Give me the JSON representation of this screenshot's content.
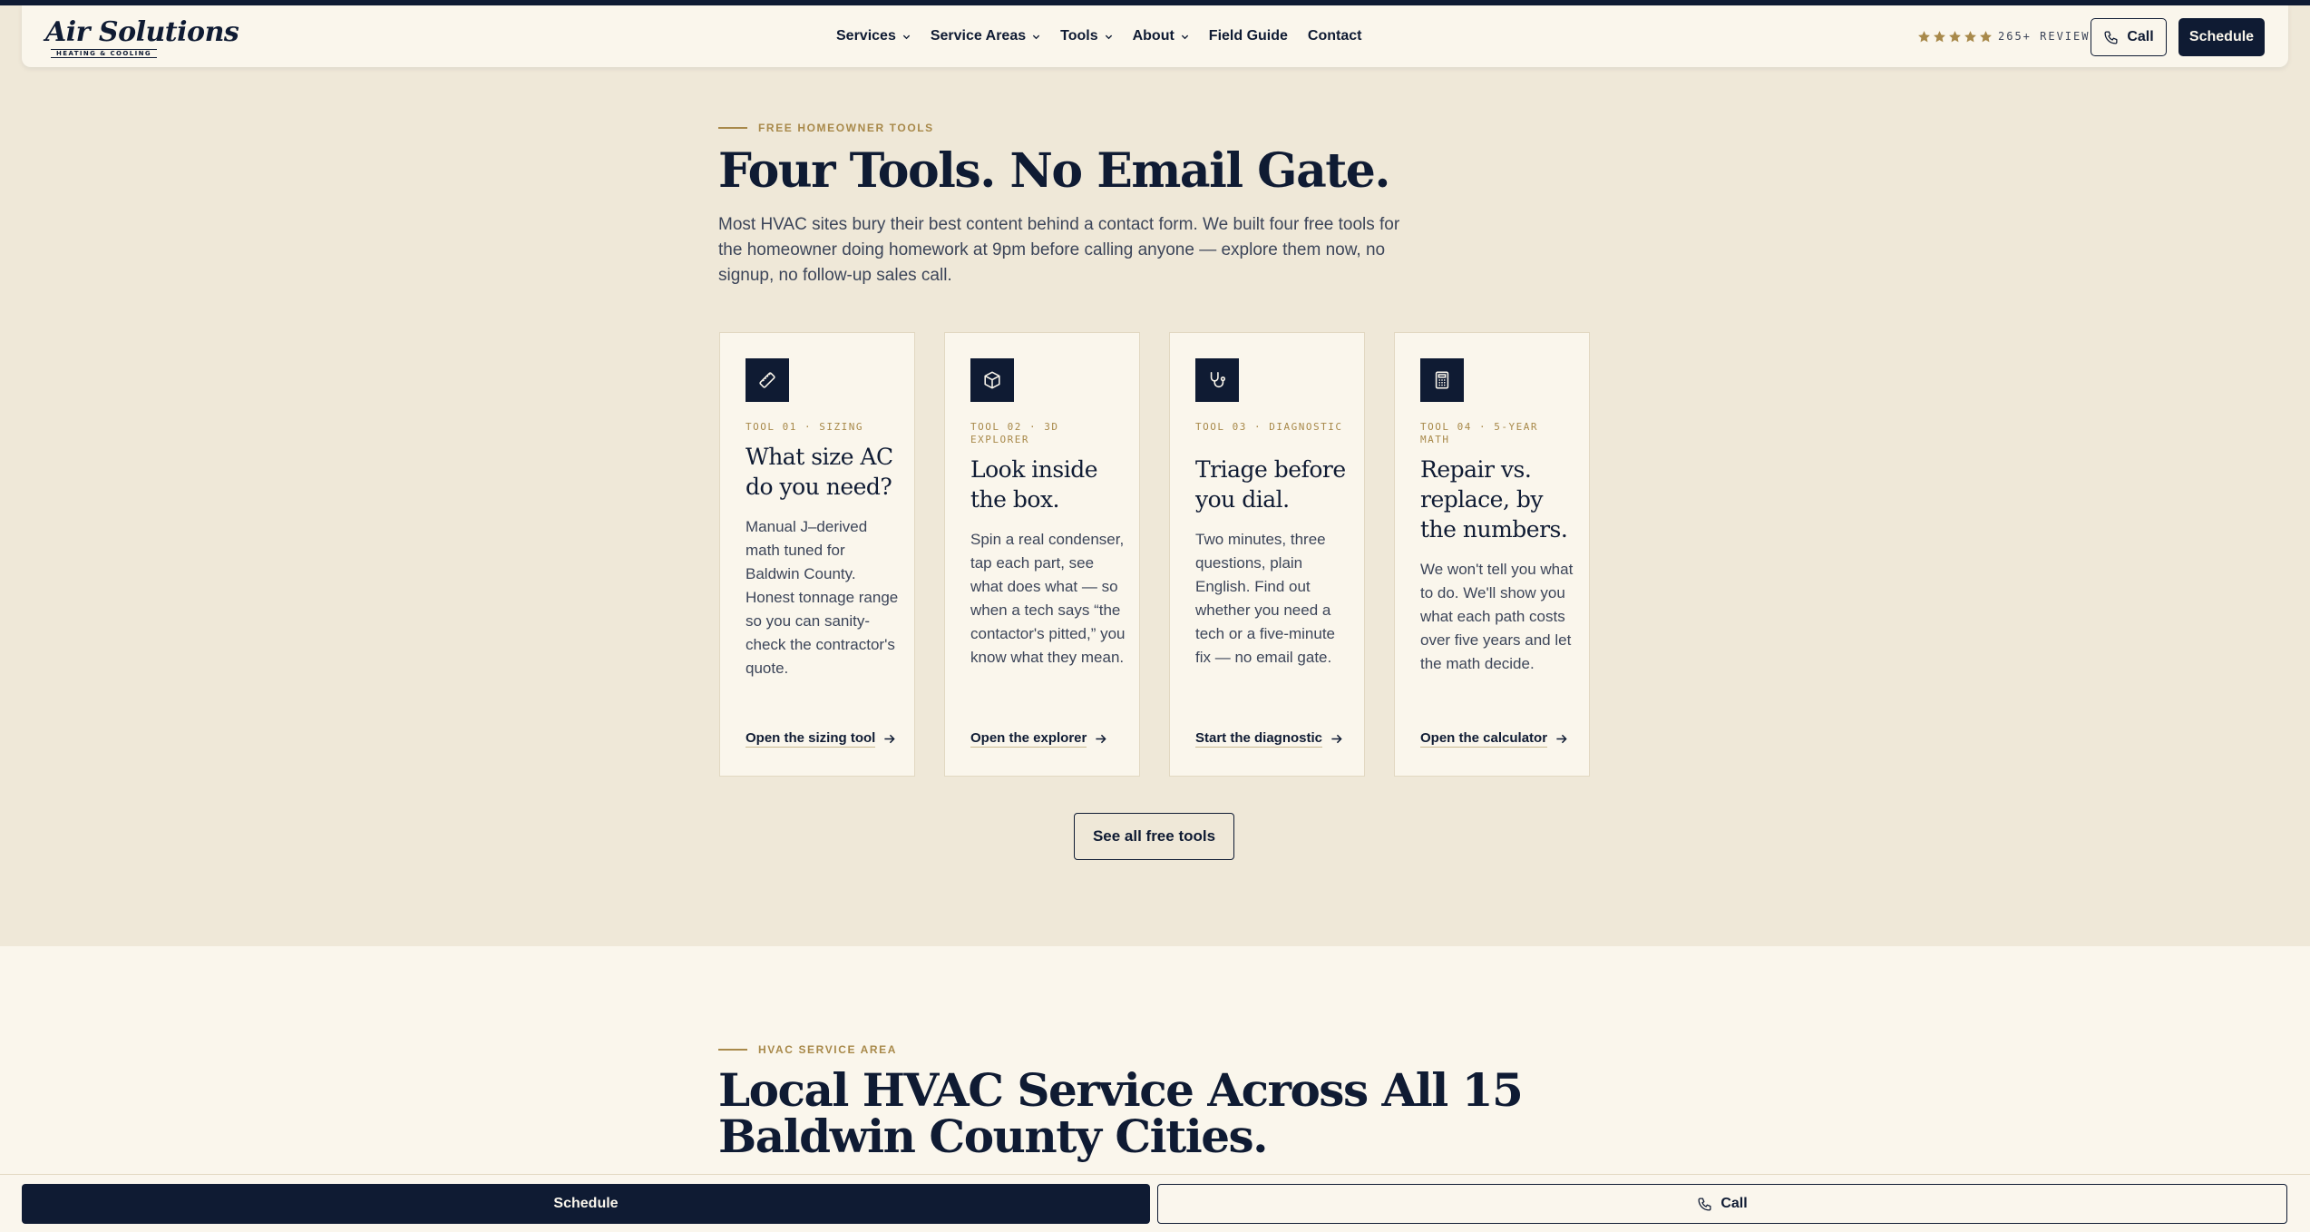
{
  "brand": {
    "name": "Air Solutions",
    "tagline": "HEATING & COOLING",
    "navy": "#0f1b33",
    "gold": "#a8894a",
    "sand": "#efe8d8",
    "cream": "#faf6ec"
  },
  "nav": {
    "items": [
      {
        "label": "Services",
        "has_dropdown": true
      },
      {
        "label": "Service Areas",
        "has_dropdown": true
      },
      {
        "label": "Tools",
        "has_dropdown": true
      },
      {
        "label": "About",
        "has_dropdown": true
      },
      {
        "label": "Field Guide",
        "has_dropdown": false
      },
      {
        "label": "Contact",
        "has_dropdown": false
      }
    ],
    "rating": {
      "stars": 5,
      "reviews_label": "265+ REVIEWS"
    },
    "call_label": "Call",
    "schedule_label": "Schedule"
  },
  "tools": {
    "eyebrow": "FREE HOMEOWNER TOOLS",
    "title": "Four Tools. No Email Gate.",
    "intro": "Most HVAC sites bury their best content behind a contact form. We built four free tools for the homeowner doing homework at 9pm before calling anyone — explore them now, no signup, no follow-up sales call.",
    "cards": [
      {
        "icon": "ruler-icon",
        "tag": "TOOL 01 · SIZING",
        "title": "What size AC do you need?",
        "body": "Manual J–derived math tuned for Baldwin County. Honest tonnage range so you can sanity-check the contractor's quote.",
        "link": "Open the sizing tool"
      },
      {
        "icon": "box-3d-icon",
        "tag": "TOOL 02 · 3D EXPLORER",
        "title": "Look inside the box.",
        "body": "Spin a real condenser, tap each part, see what does what — so when a tech says “the contactor's pitted,” you know what they mean.",
        "link": "Open the explorer"
      },
      {
        "icon": "stethoscope-icon",
        "tag": "TOOL 03 · DIAGNOSTIC",
        "title": "Triage before you dial.",
        "body": "Two minutes, three questions, plain English. Find out whether you need a tech or a five-minute fix — no email gate.",
        "link": "Start the diagnostic"
      },
      {
        "icon": "calculator-icon",
        "tag": "TOOL 04 · 5-YEAR MATH",
        "title": "Repair vs. replace, by the numbers.",
        "body": "We won't tell you what to do. We'll show you what each path costs over five years and let the math decide.",
        "link": "Open the calculator"
      }
    ],
    "see_all_label": "See all free tools"
  },
  "service_area": {
    "eyebrow": "HVAC SERVICE AREA",
    "title": "Local HVAC Service Across All 15 Baldwin County Cities."
  },
  "bottom_bar": {
    "schedule_label": "Schedule",
    "call_label": "Call"
  }
}
